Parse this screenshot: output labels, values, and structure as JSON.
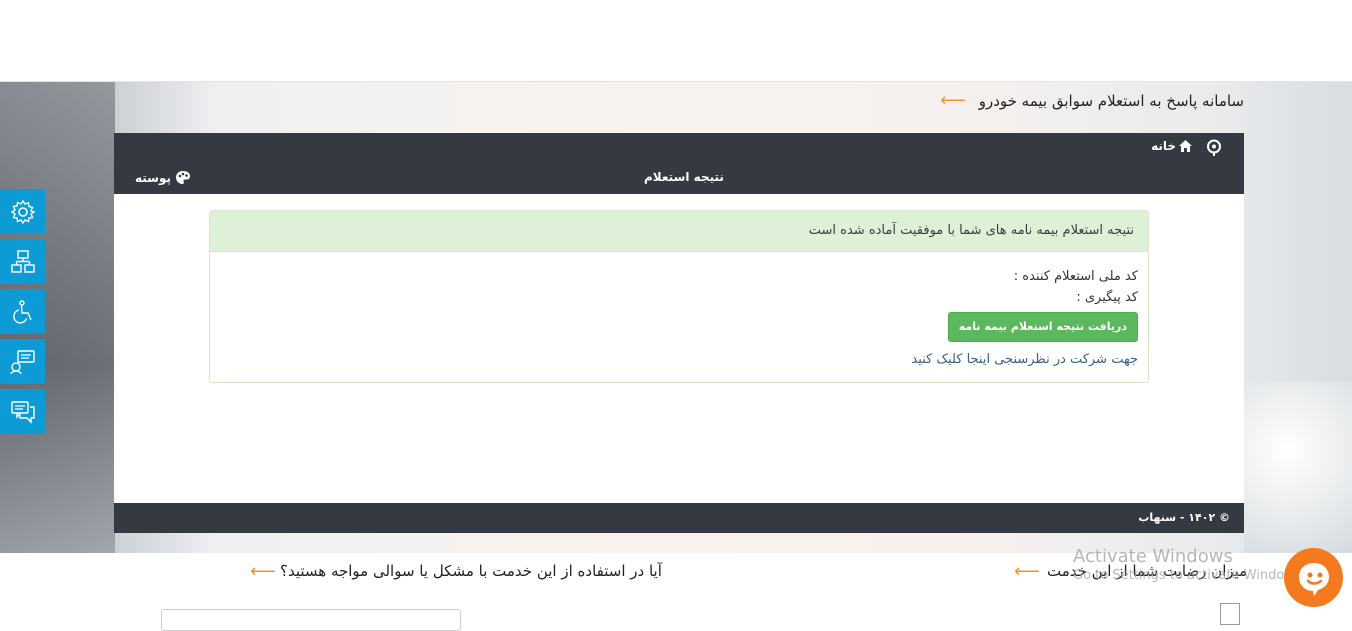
{
  "hero": {
    "title": "سامانه پاسخ به استعلام سوابق بیمه خودرو"
  },
  "navbar": {
    "home_label": "خانه",
    "page_title": "نتیجه استعلام",
    "post_label": "پوسته"
  },
  "result": {
    "success_message": "نتیجه استعلام بیمه نامه های شما با موفقیت آماده شده است",
    "national_code_label": "کد ملی استعلام کننده :",
    "tracking_code_label": "کد پیگیری :",
    "download_button": "دریافت نتیجه استعلام بیمه نامه",
    "survey_link": "جهت شرکت در نظرسنجی اینجا کلیک کنید"
  },
  "footer": {
    "copyright": "© ۱۴۰۲ - سنهاب"
  },
  "sidebar": {
    "icons": [
      "gear-icon",
      "network-icon",
      "wheelchair-icon",
      "feedback-icon",
      "chat-icon"
    ]
  },
  "bottom": {
    "satisfaction_question": "میزان رضایت شما از این خدمت",
    "problem_question": "آیا در استفاده از این خدمت با مشکل یا سوالی مواجه هستید؟"
  },
  "watermark": {
    "line1": "Activate Windows",
    "line2": "Go to Settings to activate Windows."
  },
  "colors": {
    "navbar": "#353a42",
    "accent_arrow": "#f0932b",
    "sidebar": "#0d9bd6",
    "success_bg": "#dff0d8",
    "button_green": "#5cb85c",
    "chat_bubble": "#f47a20"
  }
}
